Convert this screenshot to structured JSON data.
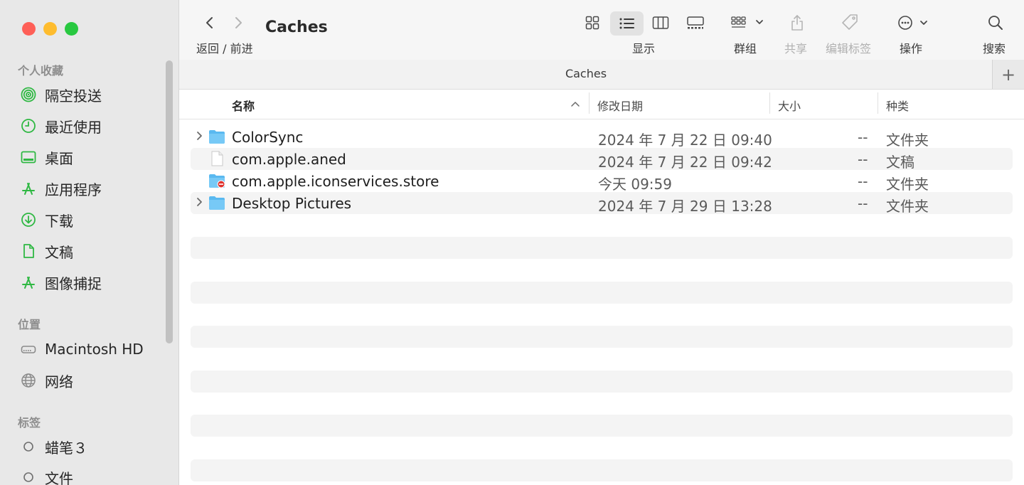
{
  "sidebar": {
    "favorites_title": "个人收藏",
    "favorites": [
      {
        "label": "隔空投送",
        "icon": "airdrop-icon"
      },
      {
        "label": "最近使用",
        "icon": "clock-icon"
      },
      {
        "label": "桌面",
        "icon": "desktop-icon"
      },
      {
        "label": "应用程序",
        "icon": "applications-icon"
      },
      {
        "label": "下载",
        "icon": "download-icon"
      },
      {
        "label": "文稿",
        "icon": "document-icon"
      },
      {
        "label": "图像捕捉",
        "icon": "applications-icon"
      }
    ],
    "locations_title": "位置",
    "locations": [
      {
        "label": "Macintosh HD",
        "icon": "disk-icon"
      },
      {
        "label": "网络",
        "icon": "network-icon"
      }
    ],
    "tags_title": "标签",
    "tags": [
      {
        "label": "蜡笔３",
        "icon": "tag-circle-icon"
      },
      {
        "label": "文件",
        "icon": "tag-circle-icon"
      }
    ]
  },
  "toolbar": {
    "nav_label": "返回 / 前进",
    "title": "Caches",
    "view_label": "显示",
    "group_label": "群组",
    "share_label": "共享",
    "tags_label": "编辑标签",
    "action_label": "操作",
    "search_label": "搜索"
  },
  "pathbar": {
    "title": "Caches",
    "add_symbol": "+"
  },
  "columns": {
    "name": "名称",
    "date": "修改日期",
    "size": "大小",
    "kind": "种类"
  },
  "files": [
    {
      "name": "ColorSync",
      "date": "2024 年 7 月 22 日 09:40",
      "size": "--",
      "kind": "文件夹",
      "type": "folder",
      "expandable": true
    },
    {
      "name": "com.apple.aned",
      "date": "2024 年 7 月 22 日 09:42",
      "size": "--",
      "kind": "文稿",
      "type": "file",
      "expandable": false
    },
    {
      "name": "com.apple.iconservices.store",
      "date": "今天 09:59",
      "size": "--",
      "kind": "文件夹",
      "type": "folder-restricted",
      "expandable": false
    },
    {
      "name": "Desktop Pictures",
      "date": "2024 年 7 月 29 日 13:28",
      "size": "--",
      "kind": "文件夹",
      "type": "folder",
      "expandable": true
    }
  ],
  "colors": {
    "accent": "#2fb843",
    "folder": "#5ab9f0",
    "red": "#fe5f57",
    "yellow": "#febc2e",
    "green": "#28c840"
  }
}
